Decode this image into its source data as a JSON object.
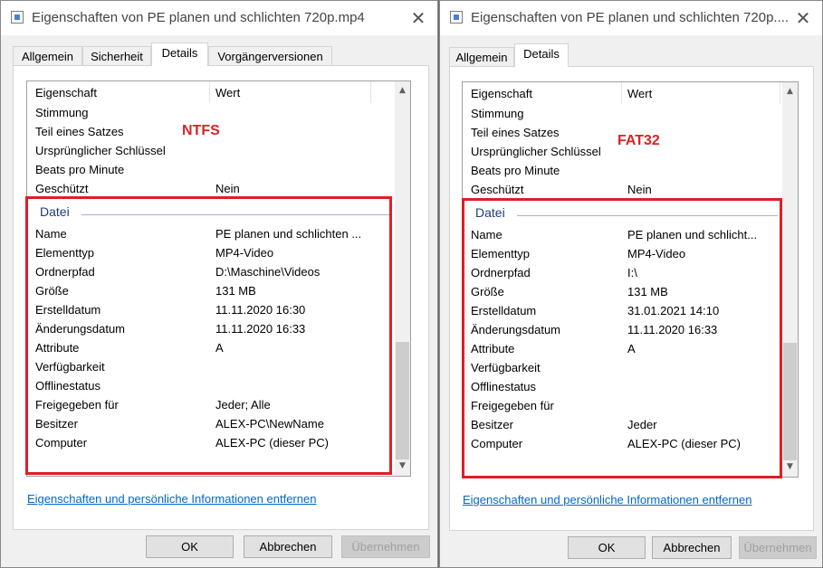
{
  "left": {
    "title": "Eigenschaften von PE planen und schlichten 720p.mp4",
    "tabs": [
      {
        "label": "Allgemein"
      },
      {
        "label": "Sicherheit"
      },
      {
        "label": "Details"
      },
      {
        "label": "Vorgängerversionen"
      }
    ],
    "header": {
      "property": "Eigenschaft",
      "value": "Wert"
    },
    "fs_label": "NTFS",
    "rows_top": [
      {
        "label": "Stimmung",
        "value": ""
      },
      {
        "label": "Teil eines Satzes",
        "value": ""
      },
      {
        "label": "Ursprünglicher Schlüssel",
        "value": ""
      },
      {
        "label": "Beats pro Minute",
        "value": ""
      },
      {
        "label": "Geschützt",
        "value": "Nein"
      }
    ],
    "group": "Datei",
    "rows": [
      {
        "label": "Name",
        "value": "PE planen und schlichten ..."
      },
      {
        "label": "Elementtyp",
        "value": "MP4-Video"
      },
      {
        "label": "Ordnerpfad",
        "value": "D:\\Maschine\\Videos"
      },
      {
        "label": "Größe",
        "value": "131 MB"
      },
      {
        "label": "Erstelldatum",
        "value": "11.11.2020 16:30"
      },
      {
        "label": "Änderungsdatum",
        "value": "11.11.2020 16:33"
      },
      {
        "label": "Attribute",
        "value": "A"
      },
      {
        "label": "Verfügbarkeit",
        "value": ""
      },
      {
        "label": "Offlinestatus",
        "value": ""
      },
      {
        "label": "Freigegeben für",
        "value": "Jeder; Alle"
      },
      {
        "label": "Besitzer",
        "value": "ALEX-PC\\NewName"
      },
      {
        "label": "Computer",
        "value": "ALEX-PC (dieser PC)"
      }
    ],
    "link": "Eigenschaften und persönliche Informationen entfernen",
    "buttons": {
      "ok": "OK",
      "cancel": "Abbrechen",
      "apply": "Übernehmen"
    }
  },
  "right": {
    "title": "Eigenschaften von PE planen und schlichten 720p....",
    "tabs": [
      {
        "label": "Allgemein"
      },
      {
        "label": "Details"
      }
    ],
    "header": {
      "property": "Eigenschaft",
      "value": "Wert"
    },
    "fs_label": "FAT32",
    "rows_top": [
      {
        "label": "Stimmung",
        "value": ""
      },
      {
        "label": "Teil eines Satzes",
        "value": ""
      },
      {
        "label": "Ursprünglicher Schlüssel",
        "value": ""
      },
      {
        "label": "Beats pro Minute",
        "value": ""
      },
      {
        "label": "Geschützt",
        "value": "Nein"
      }
    ],
    "group": "Datei",
    "rows": [
      {
        "label": "Name",
        "value": "PE planen und schlicht..."
      },
      {
        "label": "Elementtyp",
        "value": "MP4-Video"
      },
      {
        "label": "Ordnerpfad",
        "value": "I:\\"
      },
      {
        "label": "Größe",
        "value": "131 MB"
      },
      {
        "label": "Erstelldatum",
        "value": "31.01.2021 14:10"
      },
      {
        "label": "Änderungsdatum",
        "value": "11.11.2020 16:33"
      },
      {
        "label": "Attribute",
        "value": "A"
      },
      {
        "label": "Verfügbarkeit",
        "value": ""
      },
      {
        "label": "Offlinestatus",
        "value": ""
      },
      {
        "label": "Freigegeben für",
        "value": ""
      },
      {
        "label": "Besitzer",
        "value": "Jeder"
      },
      {
        "label": "Computer",
        "value": "ALEX-PC (dieser PC)"
      }
    ],
    "link": "Eigenschaften und persönliche Informationen entfernen",
    "buttons": {
      "ok": "OK",
      "cancel": "Abbrechen",
      "apply": "Übernehmen"
    }
  },
  "colors": {
    "highlight": "#dd1f26",
    "link": "#0066cc",
    "group": "#1e3c78"
  },
  "icons": {
    "title": "video-file-icon",
    "close": "close-icon",
    "scroll_up": "chevron-up-icon",
    "scroll_down": "chevron-down-icon"
  }
}
